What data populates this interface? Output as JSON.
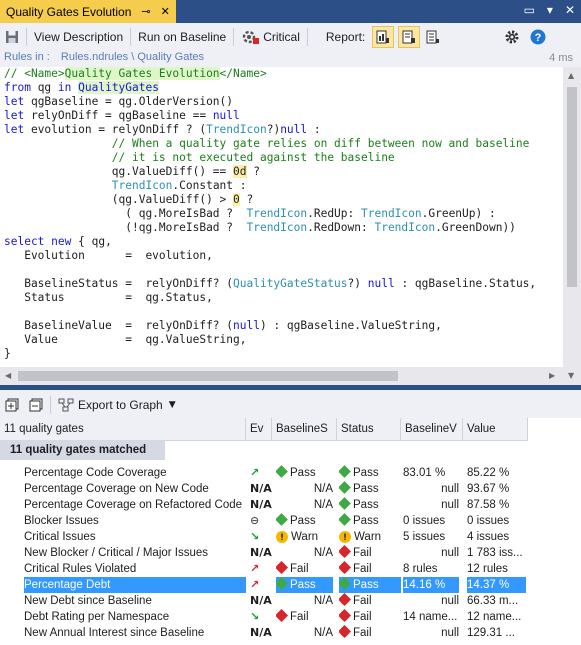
{
  "window": {
    "tab_title": "Quality Gates Evolution",
    "pin": "⊸",
    "close": "✕"
  },
  "window_buttons": [
    "▭",
    "▾",
    "✕"
  ],
  "toolbar": {
    "view_description": "View Description",
    "run_on_baseline": "Run on Baseline",
    "critical": "Critical",
    "report": "Report:"
  },
  "path": {
    "prefix": "Rules in :",
    "path": "Rules.ndrules \\ Quality Gates",
    "time": "4 ms"
  },
  "code_lines": [
    "// <Name>Quality Gates Evolution</Name>",
    "from qg in QualityGates",
    "let qgBaseline = qg.OlderVersion()",
    "let relyOnDiff = qgBaseline == null",
    "let evolution = relyOnDiff ? (TrendIcon?)null :",
    "                // When a quality gate relies on diff between now and baseline",
    "                // it is not executed against the baseline",
    "                qg.ValueDiff() == 0d ?",
    "                TrendIcon.Constant :",
    "                (qg.ValueDiff() > 0 ?",
    "                  ( qg.MoreIsBad ?  TrendIcon.RedUp: TrendIcon.GreenUp) :",
    "                  (!qg.MoreIsBad ?  TrendIcon.RedDown: TrendIcon.GreenDown))",
    "select new { qg,",
    "   Evolution      =  evolution,",
    "",
    "   BaselineStatus =  relyOnDiff? (QualityGateStatus?) null : qgBaseline.Status,",
    "   Status         =  qg.Status,",
    "",
    "   BaselineValue  =  relyOnDiff? (null) : qgBaseline.ValueString,",
    "   Value          =  qg.ValueString,",
    "}"
  ],
  "lower_toolbar": {
    "export": "Export to Graph"
  },
  "grid": {
    "columns": [
      "11 quality gates",
      "Ev",
      "BaselineS",
      "Status",
      "BaselineV",
      "Value"
    ],
    "matched_label": "11 quality gates matched",
    "rows": [
      {
        "icon": "green",
        "name": "Percentage Code Coverage",
        "ev": "↗",
        "evc": "tg",
        "bs_icon": "green",
        "bs": "Pass",
        "st_icon": "green",
        "st": "Pass",
        "bv": "83.01 %",
        "bv_align": "left",
        "val": "85.22 %"
      },
      {
        "icon": "green",
        "name": "Percentage Coverage on New Code",
        "ev": "N/A",
        "evc": "",
        "bs_icon": "",
        "bs": "N/A",
        "st_icon": "green",
        "st": "Pass",
        "bv": "null",
        "bv_align": "right",
        "val": "93.67 %"
      },
      {
        "icon": "green",
        "name": "Percentage Coverage on Refactored Code",
        "ev": "N/A",
        "evc": "",
        "bs_icon": "",
        "bs": "N/A",
        "st_icon": "green",
        "st": "Pass",
        "bv": "null",
        "bv_align": "right",
        "val": "87.58 %"
      },
      {
        "icon": "green",
        "name": "Blocker Issues",
        "ev": "⊖",
        "evc": "tn",
        "bs_icon": "green",
        "bs": "Pass",
        "st_icon": "green",
        "st": "Pass",
        "bv": "0 issues",
        "bv_align": "left",
        "val": "0 issues"
      },
      {
        "icon": "warn",
        "name": "Critical Issues",
        "ev": "↘",
        "evc": "tg",
        "bs_icon": "warn",
        "bs": "Warn",
        "st_icon": "warn",
        "st": "Warn",
        "bv": "5 issues",
        "bv_align": "left",
        "val": "4 issues"
      },
      {
        "icon": "redx",
        "name": "New Blocker / Critical / Major Issues",
        "ev": "N/A",
        "evc": "",
        "bs_icon": "",
        "bs": "N/A",
        "st_icon": "redx",
        "st": "Fail",
        "bv": "null",
        "bv_align": "right",
        "val": "1 783 iss..."
      },
      {
        "icon": "redx",
        "name": "Critical Rules Violated",
        "ev": "↗",
        "evc": "tr",
        "bs_icon": "redx",
        "bs": "Fail",
        "st_icon": "redx",
        "st": "Fail",
        "bv": "8 rules",
        "bv_align": "left",
        "val": "12 rules"
      },
      {
        "icon": "redx",
        "name": "Percentage Debt",
        "ev": "↗",
        "evc": "tr",
        "bs_icon": "green",
        "bs": "Pass",
        "st_icon": "green",
        "st": "Pass",
        "bv": "14.16 %",
        "bv_align": "left",
        "val": "14.37 %",
        "selected": true
      },
      {
        "icon": "redx",
        "name": "New Debt since Baseline",
        "ev": "N/A",
        "evc": "",
        "bs_icon": "",
        "bs": "N/A",
        "st_icon": "redx",
        "st": "Fail",
        "bv": "null",
        "bv_align": "right",
        "val": "66.33 m..."
      },
      {
        "icon": "redx",
        "name": "Debt Rating per Namespace",
        "ev": "↘",
        "evc": "tg",
        "bs_icon": "redx",
        "bs": "Fail",
        "st_icon": "redx",
        "st": "Fail",
        "bv": "14 name...",
        "bv_align": "left",
        "val": "12 name..."
      },
      {
        "icon": "redx",
        "name": "New Annual Interest since Baseline",
        "ev": "N/A",
        "evc": "",
        "bs_icon": "",
        "bs": "N/A",
        "st_icon": "redx",
        "st": "Fail",
        "bv": "null",
        "bv_align": "right",
        "val": "129.31 ..."
      }
    ]
  },
  "colors": {
    "accent": "#2d4f87",
    "tab": "#f5cc4b",
    "selection": "#3399ff",
    "pass": "#3ea945",
    "fail": "#d8262a",
    "warn": "#f5b800"
  }
}
